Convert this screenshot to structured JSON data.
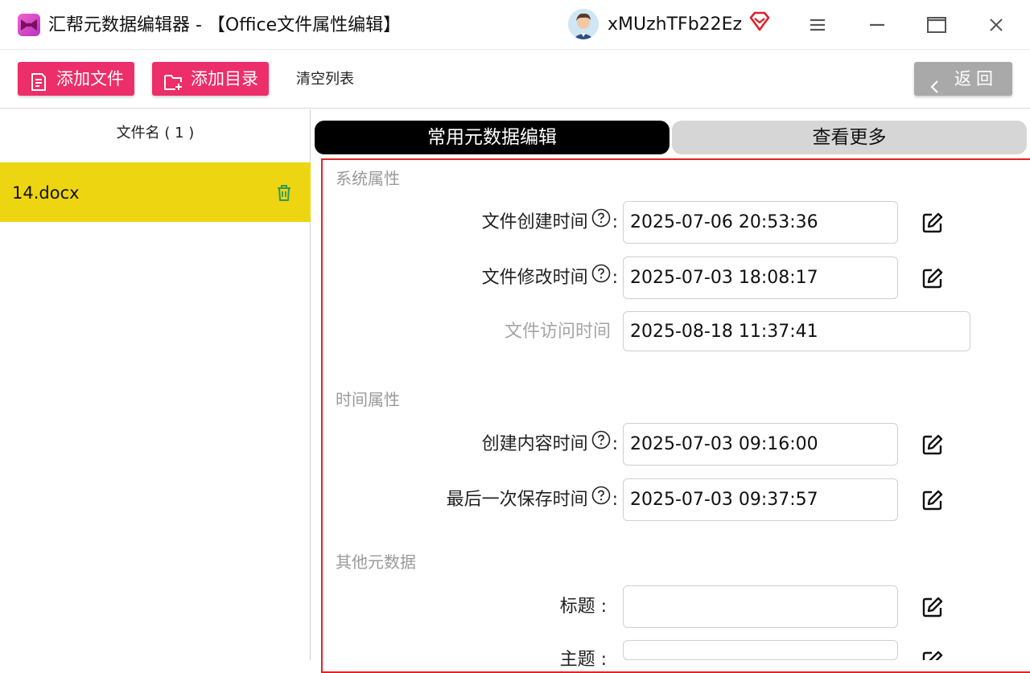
{
  "titlebar": {
    "app_title": "汇帮元数据编辑器 - 【Office文件属性编辑】",
    "username": "xMUzhTFb22Ez",
    "logo_icon": "bowtie-logo-icon",
    "vip_icon": "diamond-vip-icon",
    "window_controls": [
      "menu-icon",
      "minimize-icon",
      "maximize-icon",
      "close-icon"
    ]
  },
  "toolbar": {
    "add_file_label": "添加文件",
    "add_dir_label": "添加目录",
    "clear_label": "清空列表",
    "back_label": "返回"
  },
  "file_list": {
    "header": "文件名 ( 1 )",
    "items": [
      {
        "name": "14.docx",
        "selected": true
      }
    ]
  },
  "tabs": {
    "common": "常用元数据编辑",
    "more": "查看更多"
  },
  "sections": {
    "system": {
      "title": "系统属性",
      "created_label": "文件创建时间",
      "created_value": "2025-07-06 20:53:36",
      "modified_label": "文件修改时间",
      "modified_value": "2025-07-03 18:08:17",
      "accessed_label": "文件访问时间",
      "accessed_value": "2025-08-18 11:37:41"
    },
    "time": {
      "title": "时间属性",
      "content_created_label": "创建内容时间",
      "content_created_value": "2025-07-03 09:16:00",
      "last_saved_label": "最后一次保存时间",
      "last_saved_value": "2025-07-03 09:37:57"
    },
    "other": {
      "title": "其他元数据",
      "title_label": "标题 :",
      "title_value": "",
      "subject_label": "主题 :",
      "subject_value": ""
    }
  },
  "colors": {
    "accent_pink": "#ec2e6a",
    "selected_row": "#edd511",
    "form_border": "#e32222",
    "back_button": "#a9a9a9"
  }
}
